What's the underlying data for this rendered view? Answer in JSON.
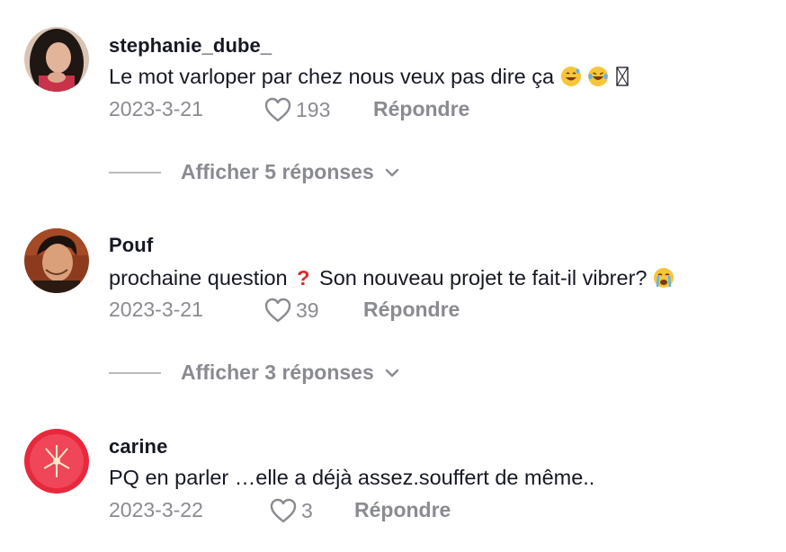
{
  "comments": [
    {
      "username": "stephanie_dube_",
      "text": "Le mot varloper par chez nous veux pas dire ça",
      "emojis": [
        "grinning-sweat-emoji",
        "tears-of-joy-emoji",
        "missing-glyph-box"
      ],
      "date": "2023-3-21",
      "likes": "193",
      "reply_label": "Répondre",
      "replies_label": "Afficher 5 réponses"
    },
    {
      "username": "Pouf",
      "text_before": "prochaine question",
      "text_after": "Son nouveau projet te fait-il vibrer?",
      "emojis": [
        "red-question-mark-emoji",
        "crying-face-emoji"
      ],
      "date": "2023-3-21",
      "likes": "39",
      "reply_label": "Répondre",
      "replies_label": "Afficher 3 réponses"
    },
    {
      "username": "carine",
      "text": "PQ en parler …elle a déjà assez.souffert de même..",
      "date": "2023-3-22",
      "likes": "3",
      "reply_label": "Répondre"
    }
  ],
  "colors": {
    "text": "#161823",
    "muted": "#8a8b91",
    "divider": "#b9babe"
  }
}
